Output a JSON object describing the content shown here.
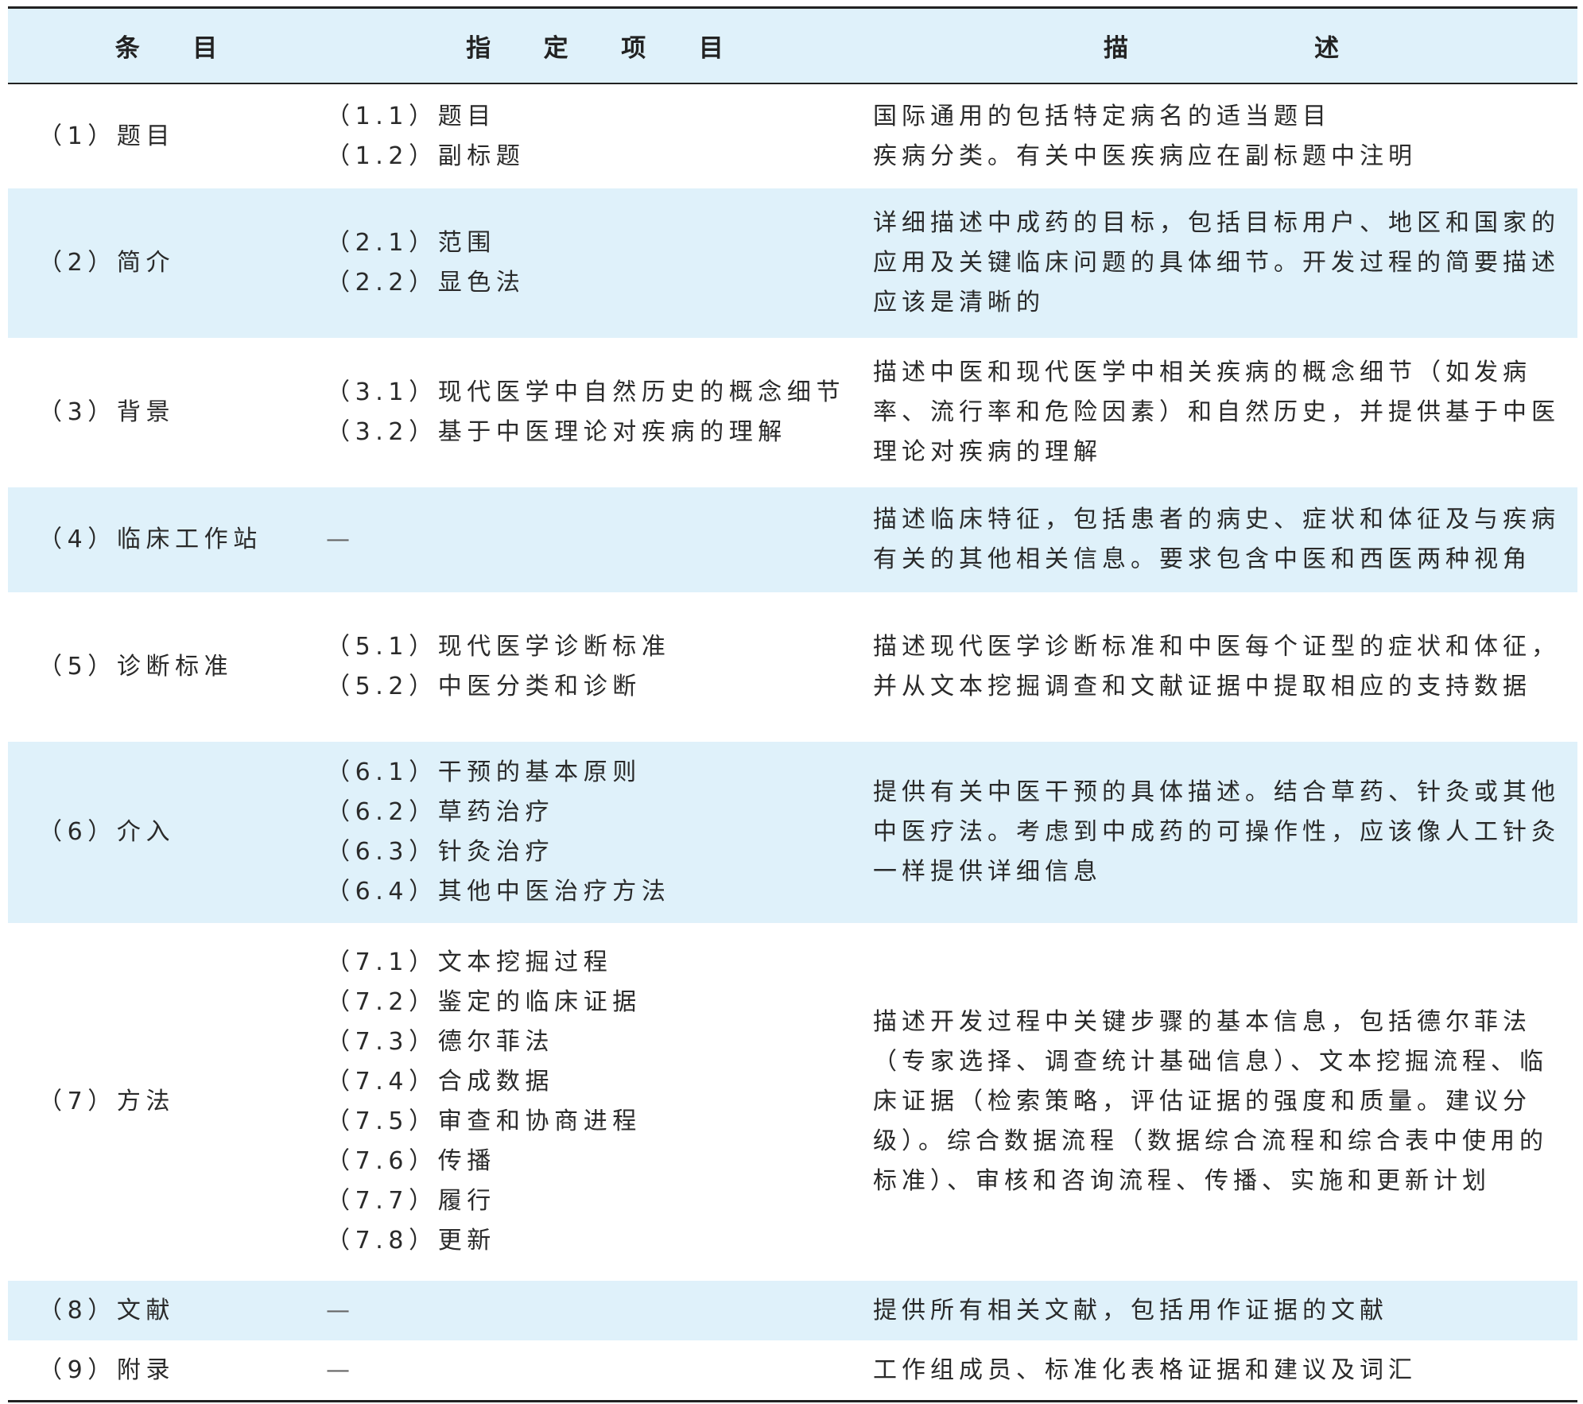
{
  "header": {
    "col1": "条 目",
    "col2": "指 定 项 目",
    "col3": "描 述"
  },
  "rows": [
    {
      "item": "（1）题目",
      "specified": [
        "（1.1）题目",
        "（1.2）副标题"
      ],
      "description": "国际通用的包括特定病名的适当题目\n疾病分类。有关中医疾病应在副标题中注明"
    },
    {
      "item": "（2）简介",
      "specified": [
        "（2.1）范围",
        "（2.2）显色法"
      ],
      "description": "详细描述中成药的目标，包括目标用户、地区和国家的应用及关键临床问题的具体细节。开发过程的简要描述应该是清晰的"
    },
    {
      "item": "（3）背景",
      "specified": [
        "（3.1）现代医学中自然历史的概念细节",
        "（3.2）基于中医理论对疾病的理解"
      ],
      "description": "描述中医和现代医学中相关疾病的概念细节（如发病率、流行率和危险因素）和自然历史，并提供基于中医理论对疾病的理解"
    },
    {
      "item": "（4）临床工作站",
      "specified": [
        "—"
      ],
      "description": "描述临床特征，包括患者的病史、症状和体征及与疾病有关的其他相关信息。要求包含中医和西医两种视角"
    },
    {
      "item": "（5）诊断标准",
      "specified": [
        "（5.1）现代医学诊断标准",
        "（5.2）中医分类和诊断"
      ],
      "description": "描述现代医学诊断标准和中医每个证型的症状和体征，并从文本挖掘调查和文献证据中提取相应的支持数据"
    },
    {
      "item": "（6）介入",
      "specified": [
        "（6.1）干预的基本原则",
        "（6.2）草药治疗",
        "（6.3）针灸治疗",
        "（6.4）其他中医治疗方法"
      ],
      "description": "提供有关中医干预的具体描述。结合草药、针灸或其他中医疗法。考虑到中成药的可操作性，应该像人工针灸一样提供详细信息"
    },
    {
      "item": "（7）方法",
      "specified": [
        "（7.1）文本挖掘过程",
        "（7.2）鉴定的临床证据",
        "（7.3）德尔菲法",
        "（7.4）合成数据",
        "（7.5）审查和协商进程",
        "（7.6）传播",
        "（7.7）履行",
        "（7.8）更新"
      ],
      "description": "描述开发过程中关键步骤的基本信息，包括德尔菲法（专家选择、调查统计基础信息）、文本挖掘流程、临床证据（检索策略，评估证据的强度和质量。建议分级）。综合数据流程（数据综合流程和综合表中使用的标准）、审核和咨询流程、传播、实施和更新计划"
    },
    {
      "item": "（8）文献",
      "specified": [
        "—"
      ],
      "description": "提供所有相关文献，包括用作证据的文献"
    },
    {
      "item": "（9）附录",
      "specified": [
        "—"
      ],
      "description": "工作组成员、标准化表格证据和建议及词汇"
    }
  ],
  "colors": {
    "row_shade": "#dff1fa",
    "rule": "#222222",
    "text": "#2a2a2a"
  }
}
